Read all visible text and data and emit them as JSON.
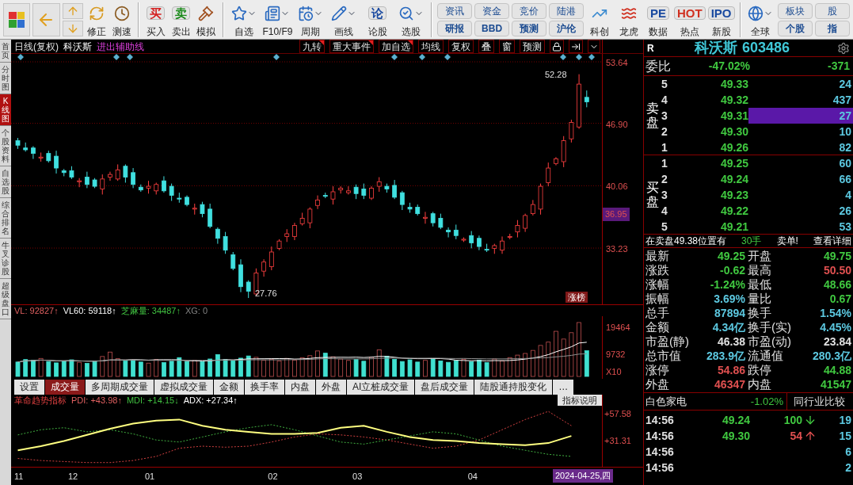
{
  "toolbar": {
    "nav": [
      {
        "label": "修正"
      },
      {
        "label": "测速"
      }
    ],
    "trade": [
      {
        "label": "买入",
        "glyph": "买"
      },
      {
        "label": "卖出",
        "glyph": "卖"
      },
      {
        "label": "模拟"
      }
    ],
    "tools": [
      {
        "label": "自选",
        "dropdown": true
      },
      {
        "label": "F10/F9",
        "dropdown": true
      },
      {
        "label": "周期",
        "dropdown": true
      },
      {
        "label": "画线",
        "dropdown": true
      },
      {
        "label": "论股",
        "glyph": "论",
        "dropdown": false
      },
      {
        "label": "选股",
        "dropdown": true
      }
    ],
    "pairs": [
      {
        "top": "资讯",
        "bottom": "研报"
      },
      {
        "top": "资金",
        "bottom": "BBD"
      },
      {
        "top": "竞价",
        "bottom": "预测"
      },
      {
        "top": "陆港",
        "bottom": "沪伦"
      }
    ],
    "apps": [
      {
        "label": "科创"
      },
      {
        "label": "龙虎"
      },
      {
        "label": "数据",
        "glyph": "PE"
      },
      {
        "label": "热点",
        "glyph": "HOT"
      },
      {
        "label": "新股",
        "glyph": "IPO"
      }
    ],
    "global": {
      "label": "全球",
      "dropdown": true
    },
    "right_pairs": [
      {
        "top": "板块",
        "bottom": "个股"
      },
      {
        "top": "股",
        "bottom": "指"
      }
    ]
  },
  "side_tabs": [
    {
      "label": "首页",
      "selected": false
    },
    {
      "label": "分时图",
      "selected": false
    },
    {
      "label": "K线图",
      "selected": true
    },
    {
      "label": "个股资料",
      "selected": false
    },
    {
      "label": "自选股",
      "selected": false
    },
    {
      "label": "综合排名",
      "selected": false
    },
    {
      "label": "牛叉诊股",
      "selected": false
    },
    {
      "label": "超级盘口",
      "selected": false
    }
  ],
  "chart_header": {
    "period": "日线(复权)",
    "stock": "科沃斯",
    "formula": "进出辅助线",
    "buttons": [
      {
        "label": "九转",
        "marked": true
      },
      {
        "label": "重大事件",
        "marked": true
      },
      {
        "label": "加自选",
        "marked": true
      },
      {
        "label": "均线",
        "marked": false
      },
      {
        "label": "复权",
        "marked": false
      },
      {
        "label": "叠",
        "marked": false
      },
      {
        "label": "窗",
        "marked": false
      },
      {
        "label": "预测",
        "marked": false
      }
    ]
  },
  "price_chart": {
    "current_price": "36.95",
    "high_label": "52.28",
    "low_label": "27.76",
    "badge": "涨榜",
    "chart_data": {
      "type": "candlestick",
      "ylim": [
        26.98,
        54.51
      ],
      "grid": true,
      "yticks": [
        {
          "value": 53.64,
          "label": "53.64"
        },
        {
          "value": 46.9,
          "label": "46.90"
        },
        {
          "value": 40.06,
          "label": "40.06"
        },
        {
          "value": 33.23,
          "label": "33.23"
        }
      ],
      "ohlc": [
        [
          45.0,
          45.3,
          44.1,
          44.5
        ],
        [
          44.2,
          44.8,
          43.8,
          44.0
        ],
        [
          44.2,
          44.4,
          43.0,
          43.6
        ],
        [
          43.1,
          43.7,
          42.7,
          43.2
        ],
        [
          43.6,
          43.9,
          42.6,
          42.8
        ],
        [
          43.3,
          43.9,
          41.4,
          42.0
        ],
        [
          41.7,
          41.9,
          41.1,
          41.5
        ],
        [
          41.7,
          42.2,
          40.8,
          41.0
        ],
        [
          40.5,
          40.9,
          39.9,
          40.6
        ],
        [
          41.0,
          41.6,
          39.8,
          40.2
        ],
        [
          40.7,
          40.9,
          39.8,
          40.0
        ],
        [
          39.7,
          41.3,
          39.1,
          40.8
        ],
        [
          41.0,
          41.6,
          40.6,
          41.3
        ],
        [
          40.8,
          42.4,
          40.6,
          41.8
        ],
        [
          42.2,
          42.4,
          40.4,
          41.0
        ],
        [
          41.5,
          42.0,
          39.8,
          40.2
        ],
        [
          39.9,
          40.2,
          39.4,
          39.6
        ],
        [
          39.8,
          40.6,
          39.2,
          40.0
        ],
        [
          39.5,
          40.4,
          39.1,
          40.2
        ],
        [
          40.6,
          41.1,
          39.3,
          39.5
        ],
        [
          40.0,
          40.3,
          38.4,
          39.0
        ],
        [
          38.7,
          39.3,
          38.2,
          38.6
        ],
        [
          38.8,
          39.0,
          37.8,
          38.0
        ],
        [
          37.5,
          38.1,
          36.9,
          37.6
        ],
        [
          38.0,
          38.3,
          36.6,
          37.0
        ],
        [
          37.5,
          38.1,
          35.4,
          35.6
        ],
        [
          35.3,
          35.5,
          33.7,
          34.3
        ],
        [
          34.5,
          35.0,
          32.6,
          33.0
        ],
        [
          32.5,
          32.8,
          30.8,
          31.0
        ],
        [
          31.4,
          32.0,
          28.4,
          29.0
        ],
        [
          29.5,
          29.7,
          27.76,
          28.5
        ],
        [
          28.2,
          31.0,
          28.0,
          30.5
        ],
        [
          30.7,
          32.0,
          30.1,
          31.7
        ],
        [
          31.2,
          33.4,
          30.8,
          32.8
        ],
        [
          33.2,
          34.2,
          33.0,
          34.0
        ],
        [
          34.5,
          35.3,
          33.9,
          34.8
        ],
        [
          34.5,
          36.0,
          34.1,
          35.7
        ],
        [
          35.9,
          37.1,
          35.7,
          36.5
        ],
        [
          36.0,
          37.7,
          35.4,
          37.5
        ],
        [
          37.9,
          39.0,
          37.5,
          38.5
        ],
        [
          39.0,
          39.3,
          38.7,
          38.9
        ],
        [
          38.6,
          40.0,
          38.0,
          39.4
        ],
        [
          39.6,
          40.0,
          39.2,
          39.8
        ],
        [
          39.3,
          40.0,
          39.1,
          39.5
        ],
        [
          39.9,
          40.2,
          38.6,
          39.2
        ],
        [
          39.7,
          40.3,
          38.6,
          39.0
        ],
        [
          38.7,
          40.0,
          38.5,
          39.8
        ],
        [
          40.0,
          41.0,
          39.4,
          40.5
        ],
        [
          40.0,
          40.3,
          39.3,
          39.7
        ],
        [
          40.1,
          40.7,
          38.6,
          38.8
        ],
        [
          39.3,
          39.5,
          37.4,
          38.0
        ],
        [
          37.7,
          38.2,
          37.1,
          37.5
        ],
        [
          37.7,
          38.0,
          36.8,
          37.0
        ],
        [
          36.5,
          37.2,
          35.9,
          36.6
        ],
        [
          37.0,
          37.2,
          35.6,
          36.0
        ],
        [
          36.5,
          37.0,
          35.3,
          35.5
        ],
        [
          35.2,
          35.5,
          34.4,
          35.0
        ],
        [
          35.2,
          35.8,
          34.2,
          34.6
        ],
        [
          34.1,
          34.4,
          33.9,
          34.2
        ],
        [
          34.6,
          35.1,
          33.2,
          33.8
        ],
        [
          34.3,
          34.6,
          33.0,
          33.4
        ],
        [
          33.1,
          33.7,
          32.8,
          33.0
        ],
        [
          33.2,
          33.7,
          32.6,
          33.5
        ],
        [
          33.0,
          34.5,
          32.6,
          34.0
        ],
        [
          34.4,
          34.8,
          34.2,
          34.5
        ],
        [
          35.0,
          36.3,
          34.4,
          35.7
        ],
        [
          35.4,
          37.0,
          35.0,
          36.8
        ],
        [
          37.0,
          38.5,
          36.8,
          38.0
        ],
        [
          37.5,
          40.3,
          36.9,
          40.0
        ],
        [
          40.4,
          42.6,
          40.0,
          42.0
        ],
        [
          42.5,
          43.2,
          42.3,
          43.0
        ],
        [
          42.7,
          45.5,
          42.1,
          45.0
        ],
        [
          45.2,
          47.3,
          44.8,
          47.0
        ],
        [
          46.5,
          52.28,
          46.3,
          51.2
        ],
        [
          49.75,
          50.5,
          48.66,
          49.25
        ]
      ]
    }
  },
  "volume": {
    "legend": [
      {
        "label": "VL: 92827↑",
        "color": "#e06060"
      },
      {
        "label": "VL60: 59118↑",
        "color": "#ffffff"
      },
      {
        "label": "芝麻量: 34487↑",
        "color": "#40c040"
      },
      {
        "label": "XG: 0",
        "color": "#808080"
      }
    ],
    "axis": [
      "19464",
      "9732",
      "X10"
    ]
  },
  "indicator_tabs": [
    {
      "label": "设置",
      "selected": false
    },
    {
      "label": "成交量",
      "selected": true
    },
    {
      "label": "多周期成交量",
      "selected": false
    },
    {
      "label": "虚拟成交量",
      "selected": false
    },
    {
      "label": "金额",
      "selected": false
    },
    {
      "label": "换手率",
      "selected": false
    },
    {
      "label": "内盘",
      "selected": false
    },
    {
      "label": "外盘",
      "selected": false
    },
    {
      "label": "AI立桩成交量",
      "selected": false
    },
    {
      "label": "盘后成交量",
      "selected": false
    },
    {
      "label": "陆股通持股变化",
      "selected": false
    },
    {
      "label": "…",
      "selected": false
    }
  ],
  "dmi": {
    "name": "革命趋势指标",
    "legend": [
      {
        "label": "PDI: +43.98↑",
        "color": "#e06060"
      },
      {
        "label": "MDI: +14.15↓",
        "color": "#40c040"
      },
      {
        "label": "ADX: +27.34↑",
        "color": "#ffffff"
      }
    ],
    "button": "指标说明",
    "axis": [
      "+57.58",
      "+31.31"
    ]
  },
  "x_axis": {
    "labels": [
      "11",
      "12",
      "01",
      "02",
      "03",
      "04"
    ],
    "cursor_date": "2024-04-25,四"
  },
  "quote": {
    "flag": "R",
    "name": "科沃斯",
    "code": "603486",
    "ratio": {
      "label": "委比",
      "percent": "-47.02%",
      "diff": "-371"
    },
    "asks": {
      "label": "卖盘",
      "levels": [
        {
          "level": "5",
          "price": "49.33",
          "volume": "24",
          "selected": false
        },
        {
          "level": "4",
          "price": "49.32",
          "volume": "437",
          "selected": false
        },
        {
          "level": "3",
          "price": "49.31",
          "volume": "27",
          "selected": true
        },
        {
          "level": "2",
          "price": "49.30",
          "volume": "10",
          "selected": false
        },
        {
          "level": "1",
          "price": "49.26",
          "volume": "82",
          "selected": false
        }
      ]
    },
    "bids": {
      "label": "买盘",
      "levels": [
        {
          "level": "1",
          "price": "49.25",
          "volume": "60",
          "selected": false
        },
        {
          "level": "2",
          "price": "49.24",
          "volume": "66",
          "selected": false
        },
        {
          "level": "3",
          "price": "49.23",
          "volume": "4",
          "selected": false
        },
        {
          "level": "4",
          "price": "49.22",
          "volume": "26",
          "selected": false
        },
        {
          "level": "5",
          "price": "49.21",
          "volume": "53",
          "selected": false
        }
      ]
    },
    "notice": {
      "text": "在卖盘49.38位置有",
      "lots": "30手",
      "alert": "卖单!",
      "link": "查看详细"
    },
    "stats": [
      {
        "label": "最新",
        "value": "49.25",
        "color": "#40c840"
      },
      {
        "label": "开盘",
        "value": "49.75",
        "color": "#40c840"
      },
      {
        "label": "涨跌",
        "value": "-0.62",
        "color": "#40c840"
      },
      {
        "label": "最高",
        "value": "50.50",
        "color": "#e05050"
      },
      {
        "label": "涨幅",
        "value": "-1.24%",
        "color": "#40c840"
      },
      {
        "label": "最低",
        "value": "48.66",
        "color": "#40c840"
      },
      {
        "label": "振幅",
        "value": "3.69%",
        "color": "#5cc8e0"
      },
      {
        "label": "量比",
        "value": "0.67",
        "color": "#40c840"
      },
      {
        "label": "总手",
        "value": "87894",
        "color": "#5cc8e0"
      },
      {
        "label": "换手",
        "value": "1.54%",
        "color": "#5cc8e0"
      },
      {
        "label": "金额",
        "value": "4.34亿",
        "color": "#5cc8e0"
      },
      {
        "label": "换手(实)",
        "value": "4.45%",
        "color": "#5cc8e0"
      },
      {
        "label": "市盈(静)",
        "value": "46.38",
        "color": "#e0e0e0"
      },
      {
        "label": "市盈(动)",
        "value": "23.84",
        "color": "#e0e0e0"
      },
      {
        "label": "总市值",
        "value": "283.9亿",
        "color": "#5cc8e0"
      },
      {
        "label": "流通值",
        "value": "280.3亿",
        "color": "#5cc8e0"
      },
      {
        "label": "涨停",
        "value": "54.86",
        "color": "#e05050"
      },
      {
        "label": "跌停",
        "value": "44.88",
        "color": "#40c840"
      },
      {
        "label": "外盘",
        "value": "46347",
        "color": "#e05050"
      },
      {
        "label": "内盘",
        "value": "41547",
        "color": "#40c840"
      }
    ],
    "industry": {
      "name": "白色家电",
      "change": "-1.02%",
      "button": "同行业比较"
    },
    "ticks": [
      {
        "time": "14:56",
        "price": "49.24",
        "volume": "100",
        "kind": "down",
        "count": "19"
      },
      {
        "time": "14:56",
        "price": "49.30",
        "volume": "54",
        "kind": "up",
        "count": "15"
      },
      {
        "time": "14:56",
        "count": "6"
      },
      {
        "time": "14:56",
        "count": "2"
      }
    ]
  }
}
